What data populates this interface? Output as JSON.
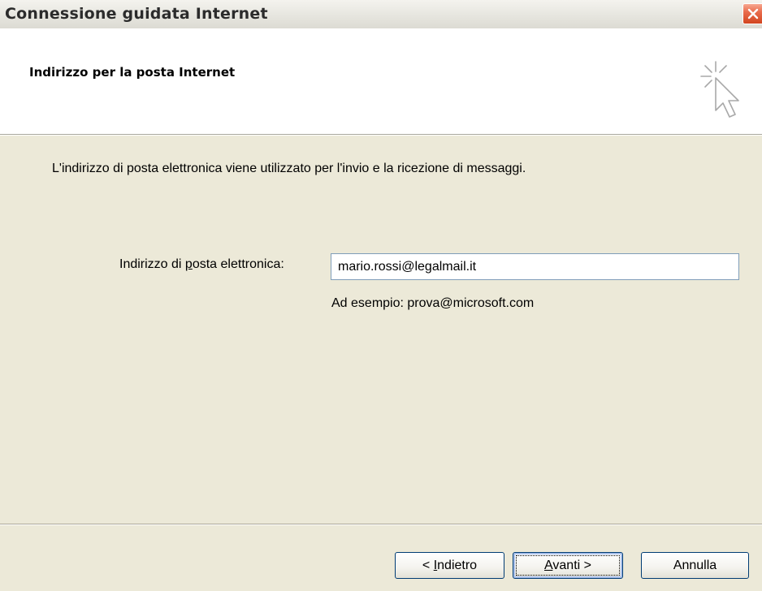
{
  "window": {
    "title": "Connessione guidata Internet"
  },
  "header": {
    "title": "Indirizzo per la posta Internet",
    "icon": "wizard-cursor-sparkle-icon"
  },
  "body": {
    "intro": "L'indirizzo di posta elettronica viene utilizzato per l'invio e la ricezione di messaggi.",
    "email_label_pre": "Indirizzo di ",
    "email_label_accel": "p",
    "email_label_post": "osta elettronica:",
    "email_value": "mario.rossi@legalmail.it",
    "example": "Ad esempio: prova@microsoft.com"
  },
  "buttons": {
    "back_pre": "< ",
    "back_accel": "I",
    "back_post": "ndietro",
    "next_accel": "A",
    "next_post": "vanti >",
    "cancel": "Annulla"
  },
  "colors": {
    "dialog_bg": "#ece9d8",
    "close_button": "#e96c4d",
    "input_border": "#7f9db9"
  }
}
